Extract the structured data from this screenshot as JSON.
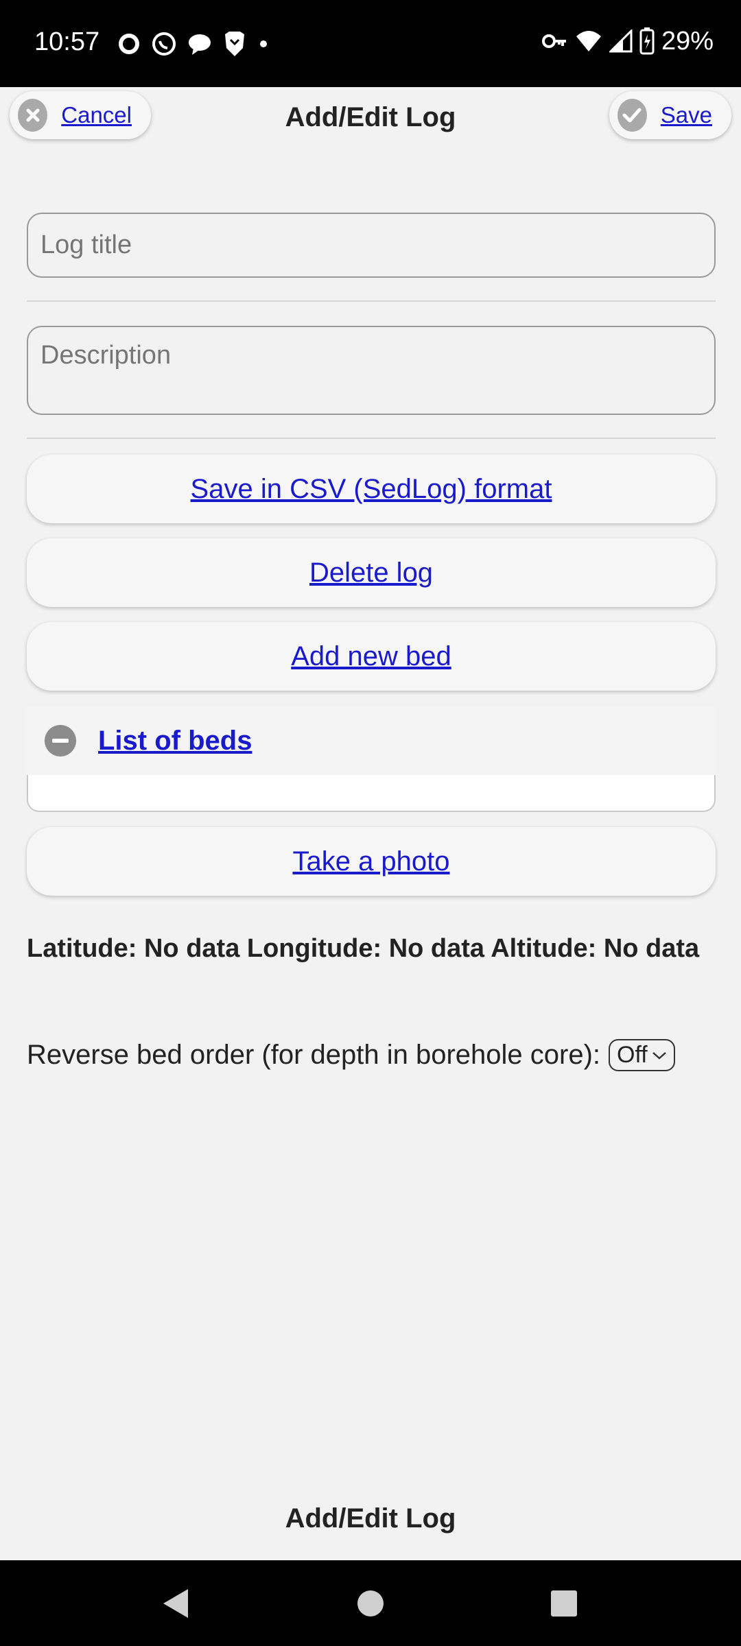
{
  "status_bar": {
    "time": "10:57",
    "battery": "29%",
    "left_icons": [
      "signal-app-icon",
      "whatsapp-icon",
      "chat-icon",
      "brave-icon",
      "dot-icon"
    ],
    "right_icons": [
      "vpn-key-icon",
      "wifi-icon",
      "cell-signal-icon",
      "battery-charging-icon"
    ]
  },
  "header": {
    "title": "Add/Edit Log",
    "cancel_label": "Cancel",
    "save_label": "Save"
  },
  "form": {
    "title_placeholder": "Log title",
    "title_value": "",
    "description_placeholder": "Description",
    "description_value": ""
  },
  "actions": {
    "save_csv_label": "Save in CSV (SedLog) format",
    "delete_label": "Delete log",
    "add_bed_label": "Add new bed",
    "list_of_beds_label": "List of beds",
    "take_photo_label": "Take a photo"
  },
  "location_text": "Latitude: No data Longitude: No data Altitude: No data",
  "reverse_order": {
    "label": "Reverse bed order (for depth in borehole core):",
    "selected": "Off"
  },
  "footer": {
    "title": "Add/Edit Log"
  },
  "colors": {
    "link": "#1a1acd",
    "background": "#f2f2f2",
    "icon_grey": "#a9a9a9"
  }
}
